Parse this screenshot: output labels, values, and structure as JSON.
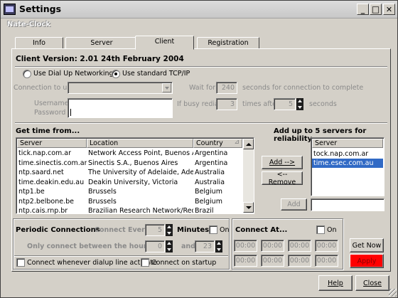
{
  "window": {
    "title": "Settings",
    "subtitle": "Nate-Clock",
    "minimize_glyph": "_",
    "maximize_glyph": "□",
    "close_glyph": "✕"
  },
  "tabs": [
    {
      "label": "Info",
      "active": false
    },
    {
      "label": "Server",
      "active": false
    },
    {
      "label": "Client",
      "active": true
    },
    {
      "label": "Registration",
      "active": false
    }
  ],
  "client": {
    "version": "Client Version: 2.01  24th February 2004",
    "radio_dialup": "Use Dial Up Networking",
    "radio_tcpip": "Use standard TCP/IP",
    "connection_to_use_label": "Connection to use",
    "wait_for_label": "Wait for",
    "wait_for_value": "240",
    "wait_for_suffix": "seconds for connection to complete",
    "username_label": "Username",
    "password_label": "Password",
    "busy_redial_label": "If busy redial",
    "busy_redial_value": "3",
    "times_after_label": "times after",
    "times_after_value": "5",
    "seconds_label": "seconds"
  },
  "servers": {
    "get_time_label": "Get time from...",
    "add_up_label": "Add up to 5 servers for reliability",
    "columns": [
      "Server",
      "Location",
      "Country"
    ],
    "sort_indicator": "⊿",
    "rows": [
      [
        "tick.nap.com.ar",
        "Network Access Point, Buenos Aires",
        "Argentina"
      ],
      [
        "time.sinectis.com.ar",
        "Sinectis S.A., Buenos Aires",
        "Argentina"
      ],
      [
        "ntp.saard.net",
        "The University of Adelaide, Adelaide",
        "Australia"
      ],
      [
        "time.deakin.edu.au",
        "Deakin University, Victoria",
        "Australia"
      ],
      [
        "ntp1.be",
        "Brussels",
        "Belgium"
      ],
      [
        "ntp2.belbone.be",
        "Brussels",
        "Belgium"
      ],
      [
        "ntp.cais.rnp.br",
        "Brazilian Research Network/Rede Na",
        "Brazil"
      ]
    ],
    "add_button": "Add -->",
    "remove_button": "<-- Remove",
    "selected_header": "Server",
    "selected": [
      "tock.nap.com.ar",
      "time.esec.com.au"
    ],
    "manual_add_button": "Add",
    "manual_add_value": ""
  },
  "periodic": {
    "title": "Periodic Connections",
    "connect_every_label": "Connect Every",
    "connect_every_value": "5",
    "minutes_label": "Minutes",
    "on_label": "On",
    "only_between_label": "Only connect between the hours of",
    "hour_from": "0",
    "and_label": "and",
    "hour_to": "23",
    "dialup_check_label": "Connect whenever dialup line activate",
    "startup_check_label": "Connect on startup"
  },
  "connect_at": {
    "title": "Connect At...",
    "on_label": "On",
    "times": [
      "00:00",
      "00:00",
      "00:00",
      "00:00",
      "00:00",
      "00:00",
      "00:00",
      "00:00"
    ]
  },
  "actions": {
    "get_now": "Get Now",
    "apply": "Apply",
    "help": "Help",
    "close": "Close"
  },
  "colors": {
    "apply_bg": "#ff0000",
    "selection": "#316ac5"
  }
}
